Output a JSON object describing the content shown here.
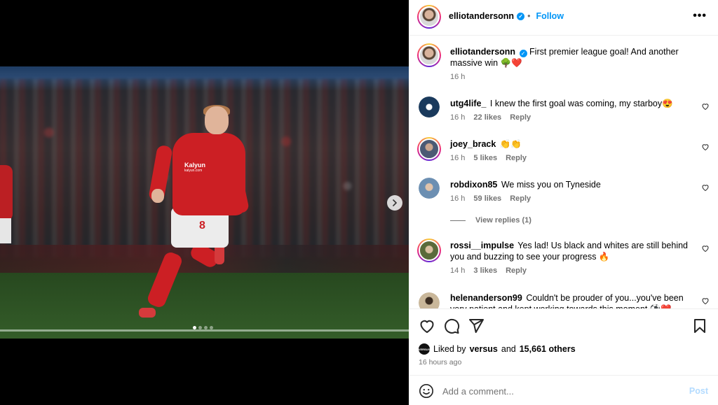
{
  "post": {
    "username": "elliotandersonn",
    "verified": true,
    "separator": "•",
    "follow_label": "Follow",
    "caption": "First premier league goal! And another massive win 🌳❤️",
    "caption_time": "16 h",
    "image_sponsor": "Kalyun",
    "image_sponsor_url": "kalyun.com",
    "shirt_number": "8",
    "carousel": {
      "count": 4,
      "active": 0
    }
  },
  "comments": [
    {
      "user": "utg4life_",
      "text": "I knew the first goal was coming, my starboy😍",
      "time": "16 h",
      "likes": "22 likes",
      "reply": "Reply",
      "avatar_color": "#1a3a5c"
    },
    {
      "user": "joey_brack",
      "text": "👏👏",
      "time": "16 h",
      "likes": "5 likes",
      "reply": "Reply",
      "avatar_color": "#4b5a74",
      "ring": true
    },
    {
      "user": "robdixon85",
      "text": "We miss you on Tyneside",
      "time": "16 h",
      "likes": "59 likes",
      "reply": "Reply",
      "avatar_color": "#6c8fb2",
      "view_replies": "View replies (1)"
    },
    {
      "user": "rossi__impulse",
      "text": "Yes lad! Us black and whites are still behind you and buzzing to see your progress 🔥",
      "time": "14 h",
      "likes": "3 likes",
      "reply": "Reply",
      "avatar_color": "#5a6a3a",
      "ring": true
    },
    {
      "user": "helenanderson99",
      "text": "Couldn't be prouder of you...you've been very patient and kept working towards this moment ⚽❤️",
      "avatar_color": "#c9b79a"
    }
  ],
  "likes": {
    "liked_by_prefix": "Liked by",
    "liked_by_user": "versus",
    "and": "and",
    "others": "15,661 others",
    "badge": "VERSUS"
  },
  "post_time": "16 hours ago",
  "comment_box": {
    "placeholder": "Add a comment...",
    "post_label": "Post"
  }
}
